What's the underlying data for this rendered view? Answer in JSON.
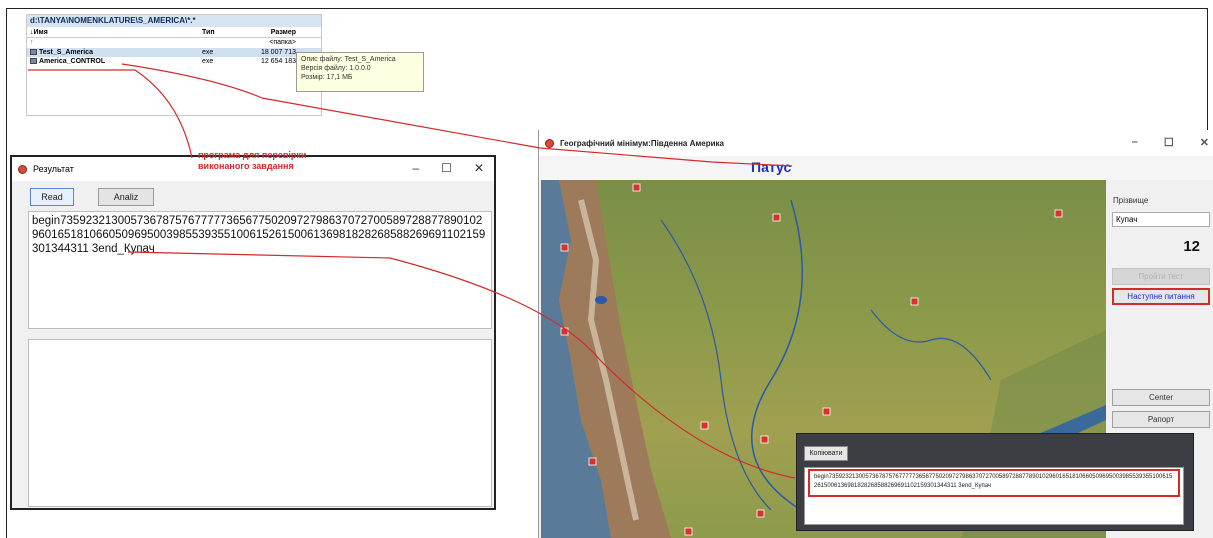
{
  "file_manager": {
    "path": "d:\\TANYA\\NOMENKLATURE\\S_AMERICA\\*.*",
    "columns": [
      "↓Имя",
      "Тип",
      "Размер"
    ],
    "rows": [
      {
        "name": "↑",
        "type": "",
        "size": "<папка>"
      },
      {
        "name": "Test_S_America",
        "type": "exe",
        "size": "18 007 713"
      },
      {
        "name": "America_CONTROL",
        "type": "exe",
        "size": "12 654 183"
      }
    ],
    "tooltip": [
      "Опис файлу: Test_S_America",
      "Версія файлу: 1.0.0.0",
      "Розмір: 17,1 МБ"
    ]
  },
  "annotation": "програма для перевірки виконаного завдання",
  "result_window": {
    "title": "Результат",
    "buttons": [
      "Read",
      "Analiz"
    ],
    "text": "begin73592321300573678757677777365677502097279863707270058972887789010296016518106605096950039855393551006152615006136981828268588269691102159301344311 3end_Купач"
  },
  "geo_window": {
    "title": "Географічний мінімум:Південна Америка",
    "object_name": "Патус",
    "surname_label": "Прізвище",
    "surname_value": "Купач",
    "score": "12",
    "buttons": {
      "take_test": "Пройти тест",
      "next_question": "Наступне питання",
      "center": "Center",
      "report": "Рапорт"
    }
  },
  "copy_popup": {
    "button": "Копіювати",
    "text": "begin73592321300573678757677777365677502097279863707270058972887789010296016518106605096950039855393551006152615006136981828268588269691102159301344311 3end_Купач"
  },
  "colors": {
    "annotation_red": "#d32a2a",
    "title_blue": "#1a2fc8"
  }
}
